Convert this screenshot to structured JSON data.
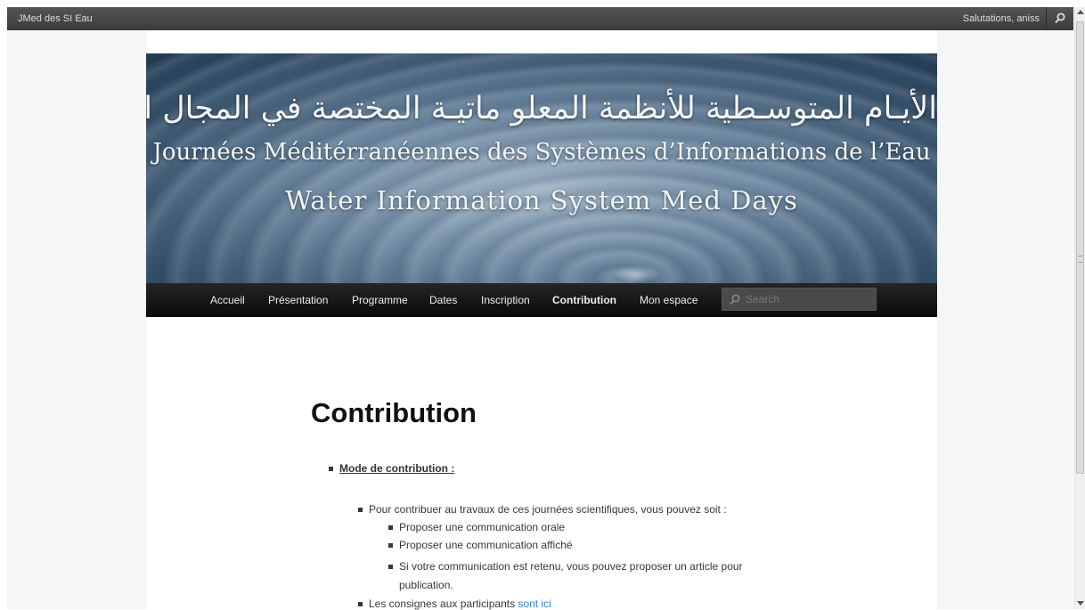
{
  "topbar": {
    "site_name": "JMed des SI Eau",
    "greeting": "Salutations, aniss",
    "search_icon": "search-icon"
  },
  "banner": {
    "arabic": "الأيـام المتوسـطية للأنظمة المعلو ماتيـة المختصة في المجال المائي",
    "french": "Journées Méditérranéennes des Systèmes d’Informations de l’Eau",
    "english": "Water Information System Med Days"
  },
  "nav": {
    "items": [
      {
        "label": "Accueil"
      },
      {
        "label": "Présentation"
      },
      {
        "label": "Programme"
      },
      {
        "label": "Dates"
      },
      {
        "label": "Inscription"
      },
      {
        "label": "Contribution"
      },
      {
        "label": "Mon espace"
      }
    ],
    "active": "Contribution",
    "search_placeholder": "Search"
  },
  "content": {
    "title": "Contribution",
    "mode_heading": "Mode de contribution :",
    "intro": "Pour contribuer au travaux de ces journées scientifiques, vous pouvez soit :",
    "options": [
      "Proposer une communication orale",
      "Proposer une communication affiché",
      "Si votre communication est retenu, vous pouvez proposer un article pour",
      "publication."
    ],
    "consignes_text": "Les consignes aux participants",
    "consignes_link": "sont ici"
  },
  "colors": {
    "link": "#1b8be0",
    "topbar": "#464646",
    "nav": "#151515"
  }
}
